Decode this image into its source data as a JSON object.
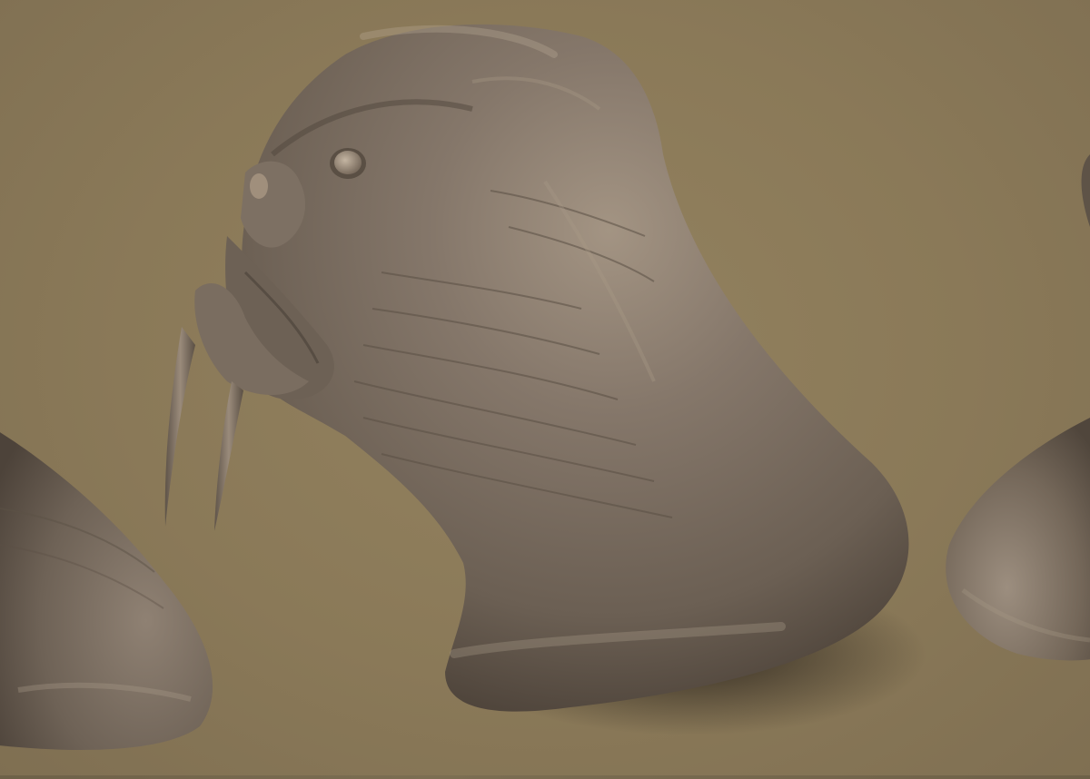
{
  "scene": {
    "background_color": "#8b7a5c",
    "clay_color": "#75695d",
    "clay_highlight": "#a39483",
    "clay_shadow": "#3d342c",
    "subjects": [
      {
        "name": "creature-bust-left",
        "visibility": "partial"
      },
      {
        "name": "creature-bust-center",
        "visibility": "full"
      },
      {
        "name": "creature-bust-right",
        "visibility": "partial"
      }
    ]
  }
}
